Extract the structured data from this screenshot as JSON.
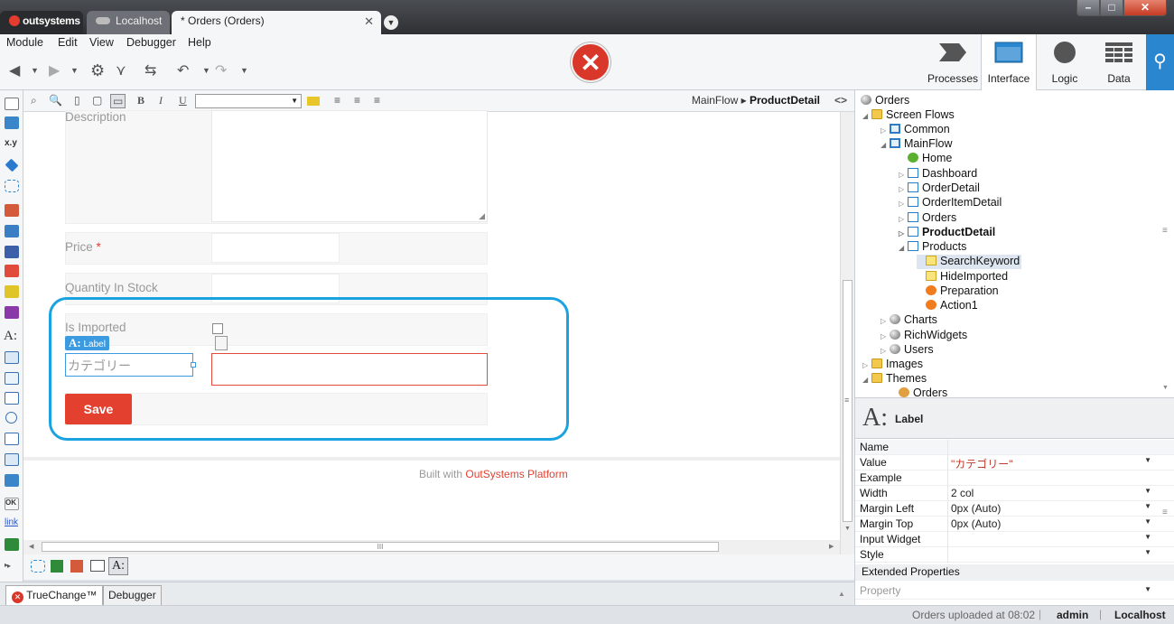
{
  "window": {
    "logo_text": "outsystems",
    "tabs": [
      {
        "label": "Localhost"
      },
      {
        "label": "* Orders (Orders)",
        "close": "✕"
      }
    ],
    "controls": {
      "minimize": "–",
      "maximize": "□",
      "close": "✕"
    }
  },
  "menu": [
    "Module",
    "Edit",
    "View",
    "Debugger",
    "Help"
  ],
  "toolbar": {
    "error_symbol": "✕"
  },
  "nav_tabs": [
    {
      "label": "Processes",
      "icon": "processes-icon"
    },
    {
      "label": "Interface",
      "icon": "interface-icon",
      "active": true
    },
    {
      "label": "Logic",
      "icon": "logic-icon"
    },
    {
      "label": "Data",
      "icon": "data-icon"
    }
  ],
  "editor": {
    "format_bold": "B",
    "format_italic": "I",
    "format_underline": "U",
    "breadcrumb": {
      "flow": "MainFlow",
      "separator": "▸",
      "screen": "ProductDetail",
      "toggle": "<>"
    }
  },
  "canvas": {
    "description_label": "Description",
    "price_label": "Price",
    "required_mark": "*",
    "quantity_label": "Quantity In Stock",
    "imported_label": "Is Imported",
    "tag_label": "Label",
    "category_label": "カテゴリー",
    "save_button": "Save",
    "footer_prefix": "Built with ",
    "footer_brand": "OutSystems Platform",
    "scroll_thumb_mark": "III"
  },
  "bottom_tabs": [
    {
      "label": "TrueChange™",
      "active": true
    },
    {
      "label": "Debugger"
    }
  ],
  "tree": {
    "root": "Orders",
    "screen_flows": "Screen Flows",
    "common": "Common",
    "main_flow": "MainFlow",
    "screens": [
      "Home",
      "Dashboard",
      "OrderDetail",
      "OrderItemDetail",
      "Orders",
      "ProductDetail",
      "Products"
    ],
    "products_children": [
      "SearchKeyword",
      "HideImported",
      "Preparation",
      "Action1"
    ],
    "other_modules": [
      "Charts",
      "RichWidgets",
      "Users"
    ],
    "images": "Images",
    "themes": "Themes",
    "theme_orders": "Orders"
  },
  "properties": {
    "header": "Label",
    "rows": [
      {
        "name": "Name",
        "value": ""
      },
      {
        "name": "Value",
        "value": "\"カテゴリー\"",
        "dropdown": true
      },
      {
        "name": "Example",
        "value": ""
      },
      {
        "name": "Width",
        "value": "2 col",
        "dropdown": true
      },
      {
        "name": "Margin Left",
        "value": "0px (Auto)",
        "dropdown": true
      },
      {
        "name": "Margin Top",
        "value": "0px (Auto)",
        "dropdown": true
      },
      {
        "name": "Input Widget",
        "value": "",
        "dropdown": true
      },
      {
        "name": "Style",
        "value": "",
        "dropdown": true
      }
    ],
    "extended_header": "Extended Properties",
    "extended_placeholder": "Property"
  },
  "status": {
    "message": "Orders uploaded at 08:02",
    "user": "admin",
    "server": "Localhost"
  },
  "colors": {
    "accent_blue": "#2a87cf",
    "error_red": "#d8372a",
    "save_red": "#e4402f",
    "highlight_outline": "#1aa3e0"
  }
}
